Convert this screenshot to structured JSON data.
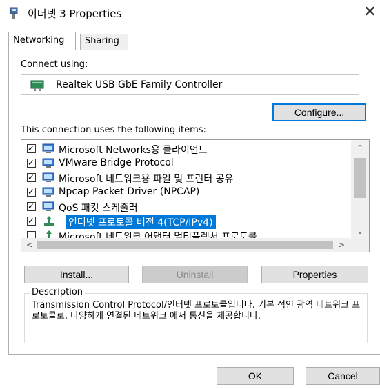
{
  "window": {
    "title": "이더넷 3 Properties",
    "close_glyph": "✕"
  },
  "tabs": [
    {
      "label": "Networking",
      "active": true
    },
    {
      "label": "Sharing",
      "active": false
    }
  ],
  "connect_using": {
    "label": "Connect using:",
    "adapter": "Realtek USB GbE Family Controller",
    "configure_label": "Configure..."
  },
  "items_section": {
    "label": "This connection uses the following items:",
    "items": [
      {
        "label": "Microsoft Networks용 클라이언트",
        "checked": true,
        "icon": "network-client-icon"
      },
      {
        "label": "VMware Bridge Protocol",
        "checked": true,
        "icon": "network-service-icon"
      },
      {
        "label": "Microsoft 네트워크용 파일 및 프린터 공유",
        "checked": true,
        "icon": "network-service-icon"
      },
      {
        "label": "Npcap Packet Driver (NPCAP)",
        "checked": true,
        "icon": "network-service-icon"
      },
      {
        "label": "QoS 패킷 스케줄러",
        "checked": true,
        "icon": "network-service-icon"
      },
      {
        "label": "인터넷 프로토콜 버전 4(TCP/IPv4)",
        "checked": true,
        "icon": "protocol-icon",
        "selected": true
      },
      {
        "label": "Microsoft 네트워크 어댑터 멀티플렉서 프로토콜",
        "checked": false,
        "icon": "protocol-icon"
      }
    ],
    "tick_glyph": "✓"
  },
  "buttons": {
    "install": "Install...",
    "uninstall": "Uninstall",
    "properties": "Properties",
    "ok": "OK",
    "cancel": "Cancel"
  },
  "description": {
    "title": "Description",
    "text": "Transmission Control Protocol/인터넷 프로토콜입니다. 기본 적인 광역 네트워크 프로토콜로, 다양하게 연결된 네트워크 에서 통신을 제공합니다."
  },
  "scroll_glyphs": {
    "up": "⌃",
    "down": "⌄",
    "left": "<",
    "right": ">"
  },
  "colors": {
    "accent": "#0078d7",
    "button_face": "#e1e1e1"
  }
}
